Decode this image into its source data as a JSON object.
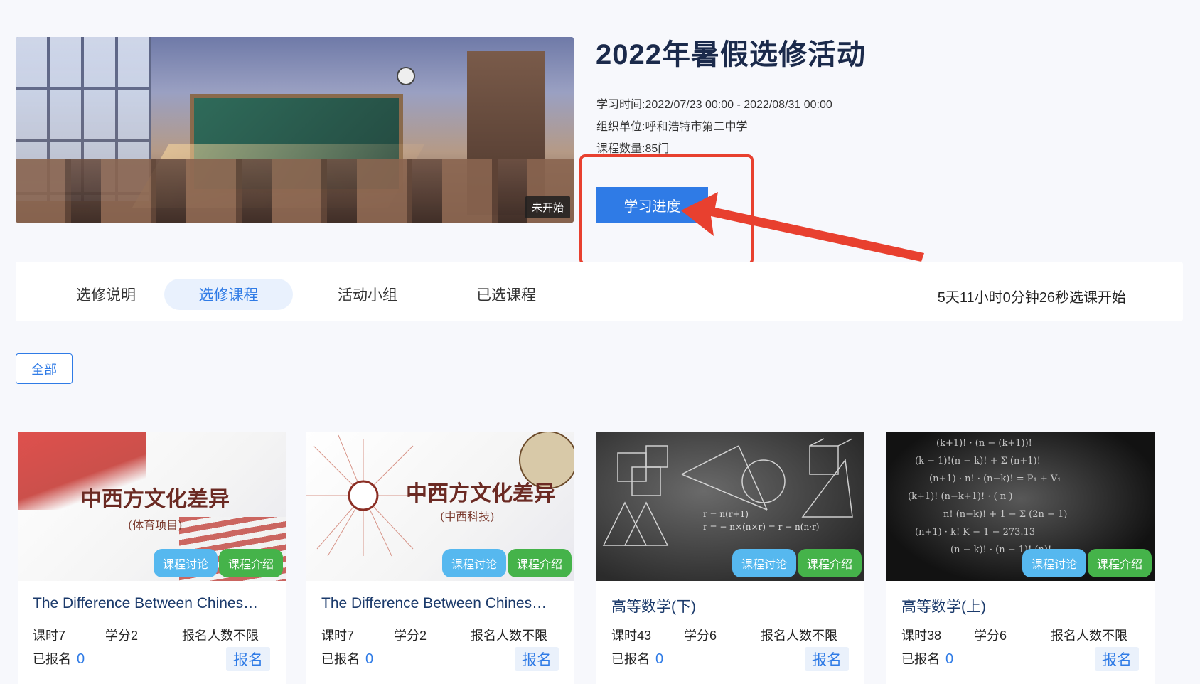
{
  "activity": {
    "title": "2022年暑假选修活动",
    "status_tag": "未开始",
    "study_time_label": "学习时间:",
    "study_time_value": "2022/07/23 00:00 - 2022/08/31 00:00",
    "org_label": "组织单位:",
    "org_value": "呼和浩特市第二中学",
    "course_count_label": "课程数量:",
    "course_count_value": "85门",
    "progress_button": "学习进度"
  },
  "tabs": [
    {
      "label": "选修说明",
      "active": false
    },
    {
      "label": "选修课程",
      "active": true
    },
    {
      "label": "活动小组",
      "active": false
    },
    {
      "label": "已选课程",
      "active": false
    }
  ],
  "countdown": "5天11小时0分钟26秒选课开始",
  "filter": {
    "all_label": "全部"
  },
  "card_labels": {
    "discuss": "课程讨论",
    "intro": "课程介绍",
    "enrolled_label": "已报名",
    "signup": "报名",
    "limit": "报名人数不限"
  },
  "courses": [
    {
      "name": "The Difference Between Chines…",
      "hours": "课时7",
      "credit": "学分2",
      "enrolled": "0",
      "cover_title": "中西方文化差异",
      "cover_subtitle": "(体育项目)"
    },
    {
      "name": "The Difference Between Chines…",
      "hours": "课时7",
      "credit": "学分2",
      "enrolled": "0",
      "cover_title": "中西方文化差异",
      "cover_subtitle": "(中西科技)"
    },
    {
      "name": "高等数学(下)",
      "hours": "课时43",
      "credit": "学分6",
      "enrolled": "0"
    },
    {
      "name": "高等数学(上)",
      "hours": "课时38",
      "credit": "学分6",
      "enrolled": "0"
    }
  ],
  "colors": {
    "primary": "#2f7be6",
    "annotation_red": "#e8402f",
    "discuss_badge": "#56b8ef",
    "intro_badge": "#45b34a",
    "title_navy": "#1b2a4b"
  }
}
